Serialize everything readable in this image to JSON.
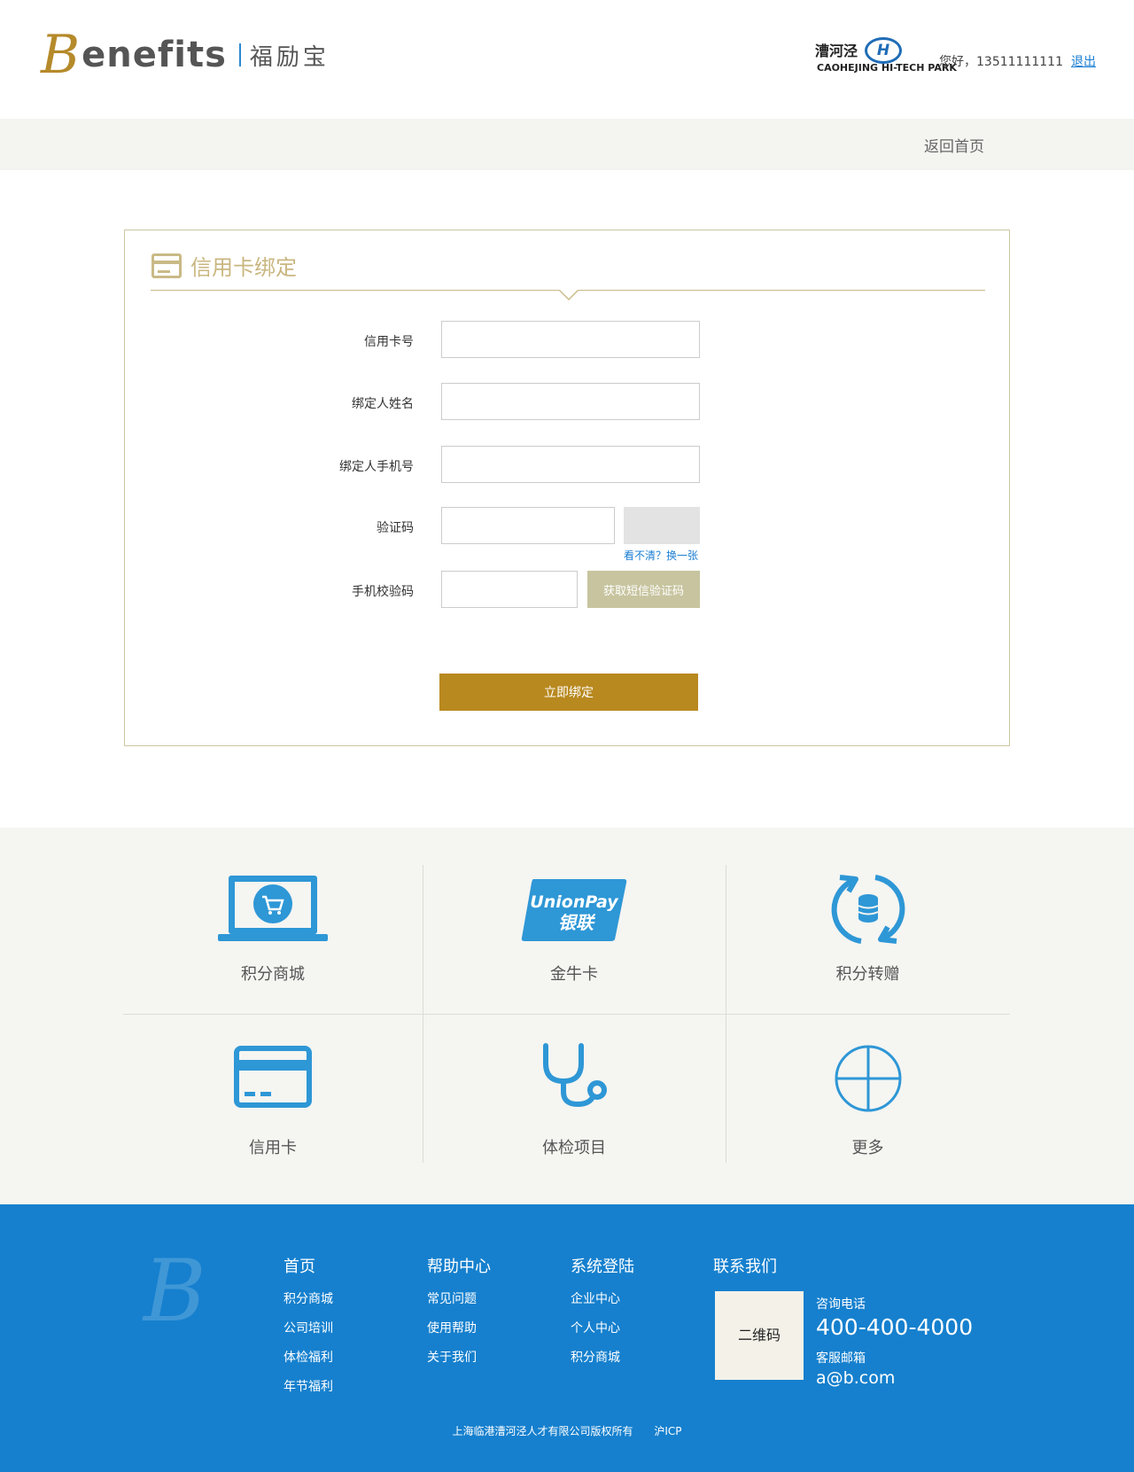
{
  "header": {
    "logo_b": "B",
    "logo_word": "enefits",
    "logo_cn": "福励宝",
    "park_cn": "漕河泾",
    "park_h": "H",
    "park_en": "CAOHEJING HI-TECH PARK",
    "greeting": "您好，13511111111",
    "logout": "退出"
  },
  "subnav": {
    "back_home": "返回首页"
  },
  "form": {
    "title": "信用卡绑定",
    "card_number_label": "信用卡号",
    "name_label": "绑定人姓名",
    "phone_label": "绑定人手机号",
    "captcha_label": "验证码",
    "captcha_refresh": "看不清？换一张",
    "sms_label": "手机校验码",
    "sms_button": "获取短信验证码",
    "submit": "立即绑定",
    "card_number_value": "",
    "name_value": "",
    "phone_value": "",
    "captcha_value": "",
    "sms_value": ""
  },
  "services": [
    {
      "label": "积分商城",
      "icon": "laptop-cart-icon"
    },
    {
      "label": "金牛卡",
      "icon": "unionpay-icon",
      "icon_text_1": "UnionPay",
      "icon_text_2": "银联"
    },
    {
      "label": "积分转赠",
      "icon": "coins-transfer-icon"
    },
    {
      "label": "信用卡",
      "icon": "credit-card-icon"
    },
    {
      "label": "体检项目",
      "icon": "stethoscope-icon"
    },
    {
      "label": "更多",
      "icon": "plus-circle-icon"
    }
  ],
  "footer": {
    "logo_b": "B",
    "columns": [
      {
        "title": "首页",
        "links": [
          "积分商城",
          "公司培训",
          "体检福利",
          "年节福利"
        ]
      },
      {
        "title": "帮助中心",
        "links": [
          "常见问题",
          "使用帮助",
          "关于我们"
        ]
      },
      {
        "title": "系统登陆",
        "links": [
          "企业中心",
          "个人中心",
          "积分商城"
        ]
      },
      {
        "title": "联系我们",
        "links": []
      }
    ],
    "qr_label": "二维码",
    "phone_label": "咨询电话",
    "phone": "400-400-4000",
    "email_label": "客服邮箱",
    "email": "a@b.com",
    "copyright": "上海临港漕河泾人才有限公司版权所有",
    "icp": "沪ICP"
  },
  "colors": {
    "brand_gold": "#b8891f",
    "accent_blue": "#1680ce",
    "icon_blue": "#2e97d6",
    "panel_border": "#cdc6a2"
  }
}
